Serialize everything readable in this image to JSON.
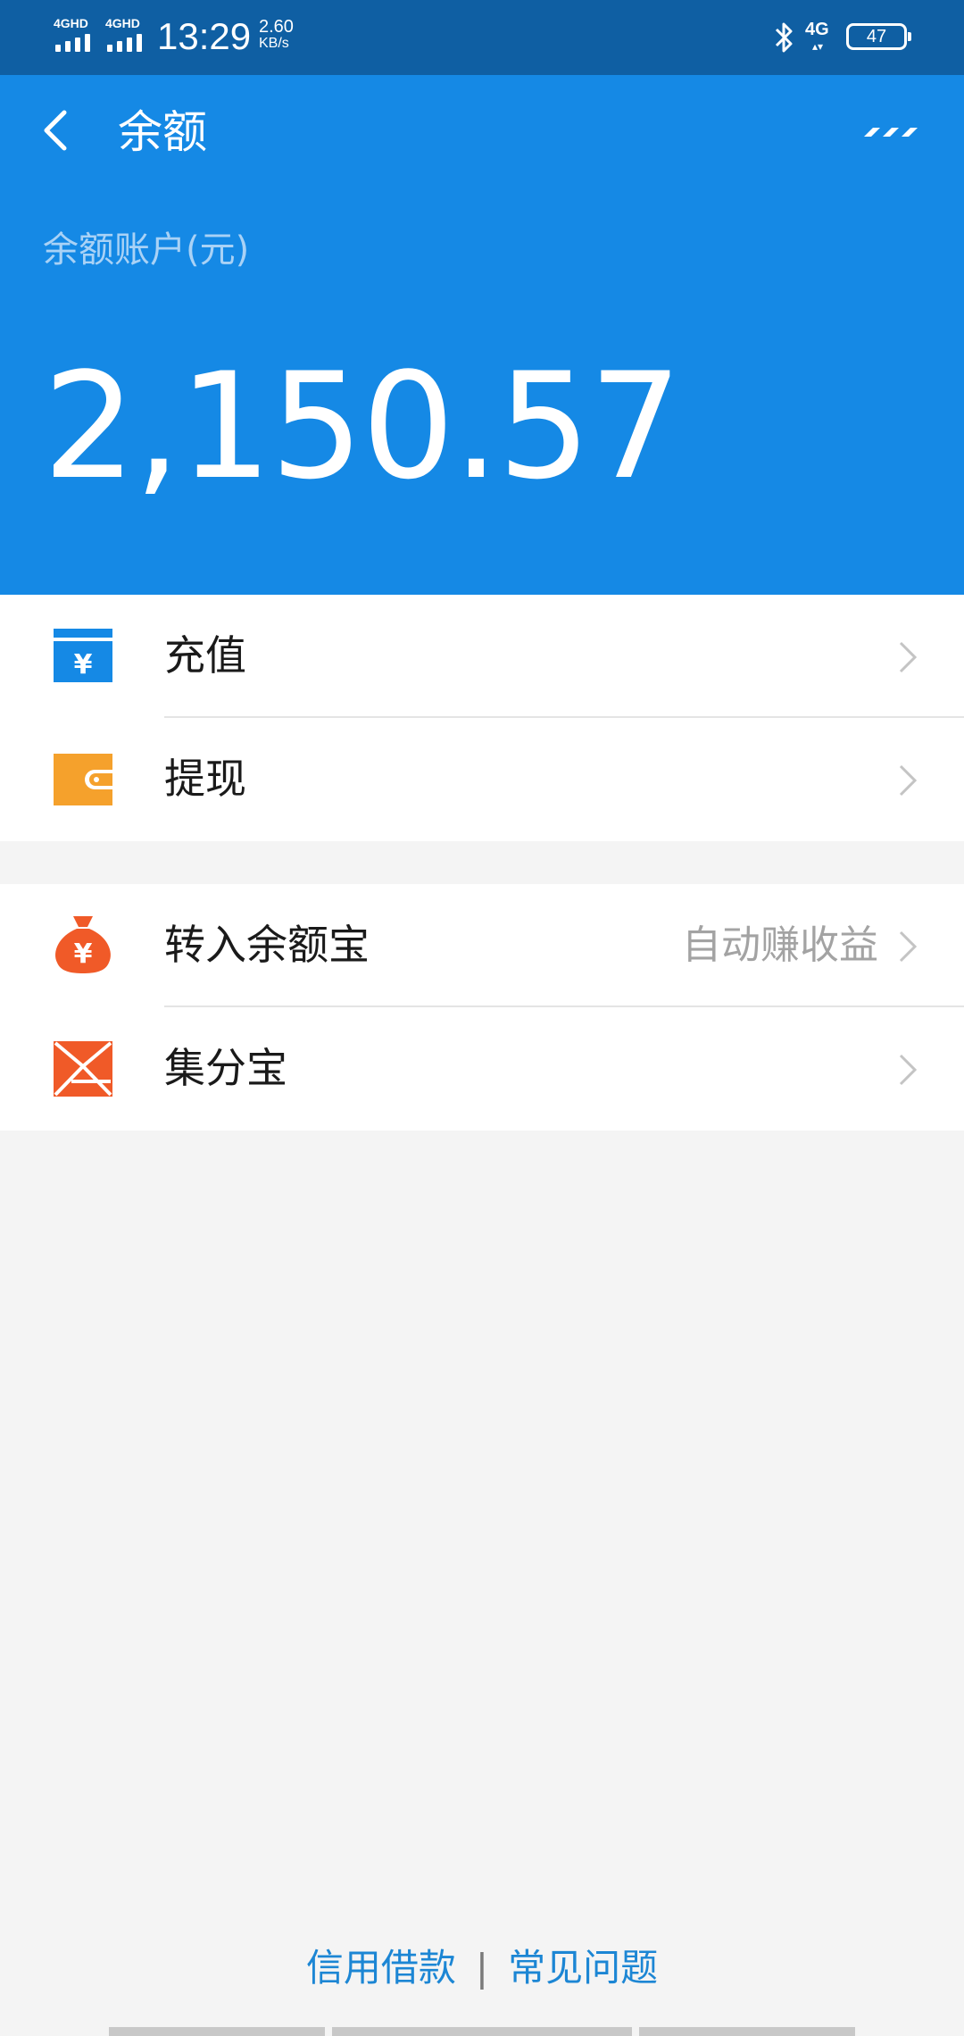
{
  "status_bar": {
    "network_1": "4GHD",
    "network_2": "4GHD",
    "time": "13:29",
    "speed_value": "2.60",
    "speed_unit": "KB/s",
    "mobile_data": "4G",
    "battery": "47"
  },
  "header": {
    "title": "余额",
    "balance_label": "余额账户(元)",
    "balance_amount": "2,150.57"
  },
  "menu_group_1": [
    {
      "label": "充值",
      "icon": "recharge-icon"
    },
    {
      "label": "提现",
      "icon": "wallet-icon"
    }
  ],
  "menu_group_2": [
    {
      "label": "转入余额宝",
      "hint": "自动赚收益",
      "icon": "money-bag-icon"
    },
    {
      "label": "集分宝",
      "icon": "jifenbao-icon"
    }
  ],
  "footer": {
    "credit_loan": "信用借款",
    "separator": "|",
    "faq": "常见问题"
  },
  "colors": {
    "header_blue": "#1589e5",
    "status_bar_blue": "#0f5fa3",
    "recharge_icon": "#1589e5",
    "wallet_icon": "#f5a12c",
    "orange_red_icon": "#f05a28",
    "link_blue": "#1c86d4"
  }
}
